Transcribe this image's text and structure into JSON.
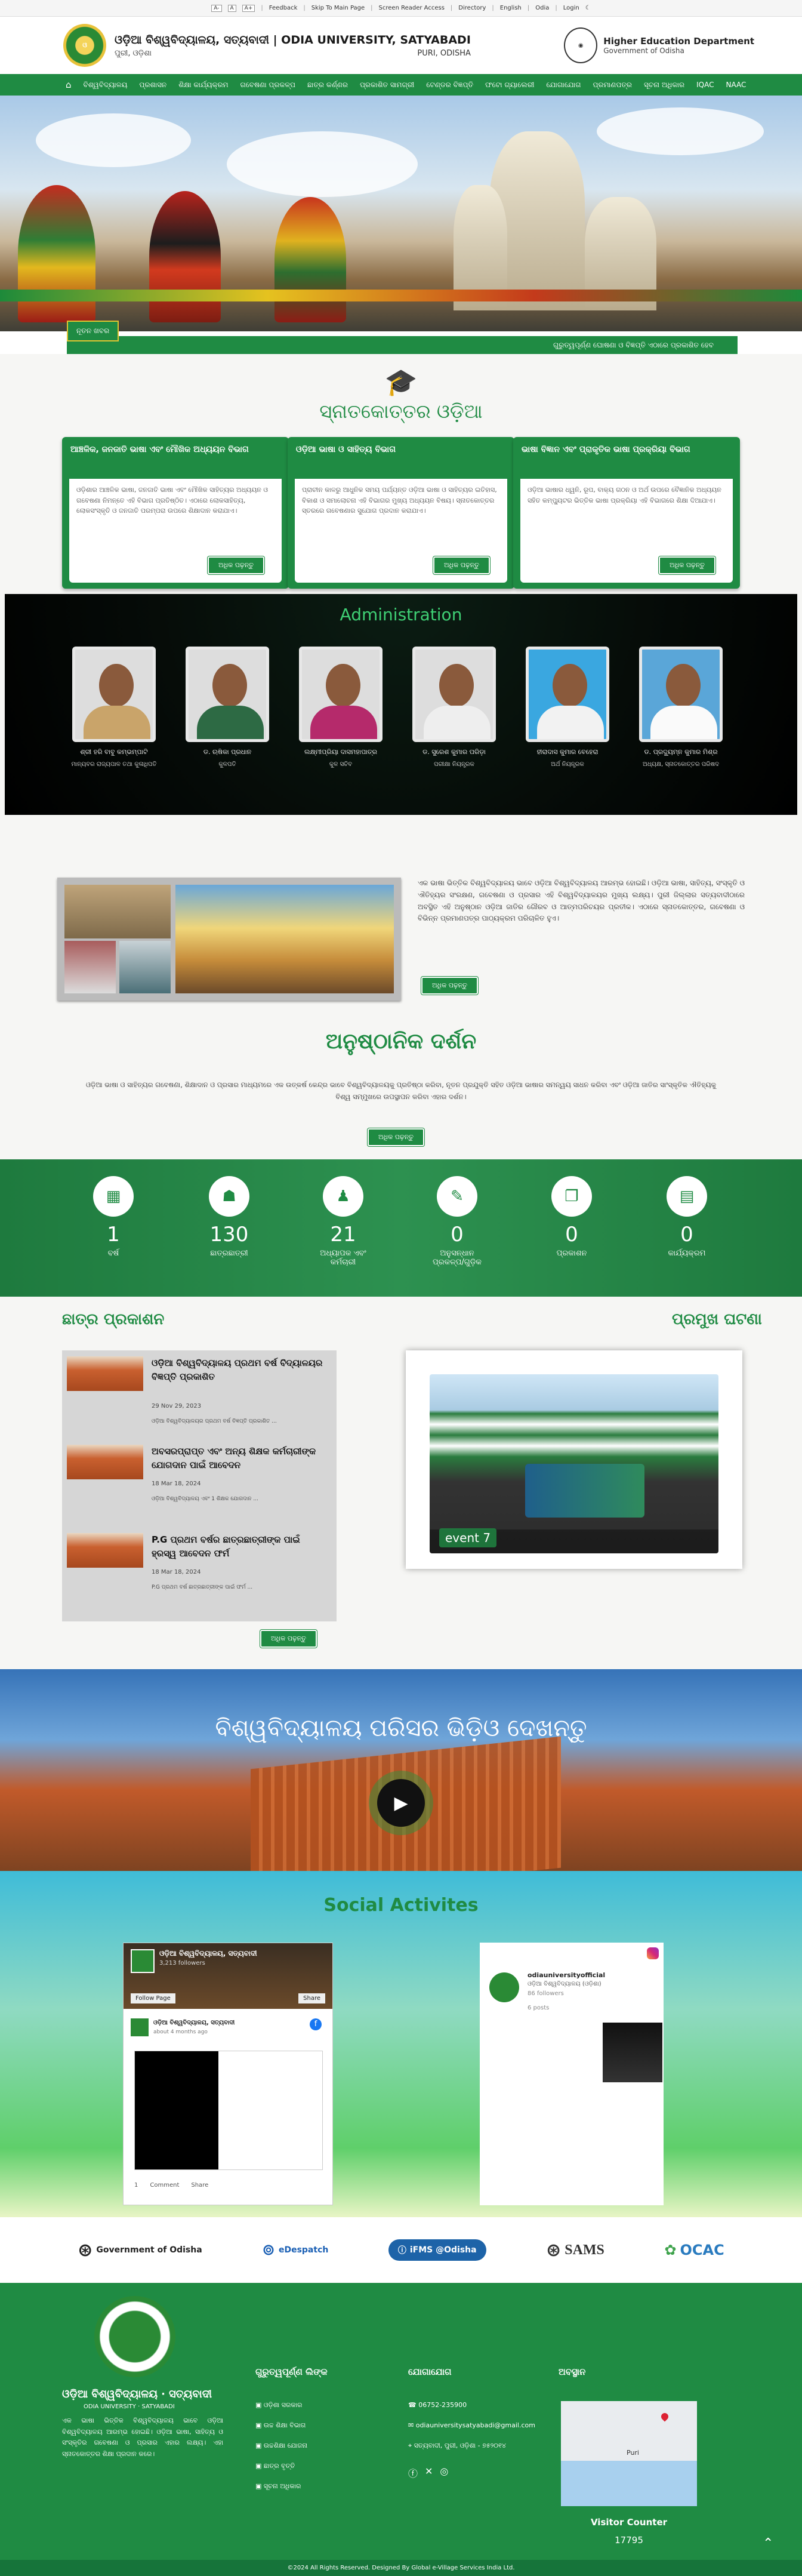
{
  "topbar": {
    "font_small": "A-",
    "font_normal": "A",
    "font_large": "A+",
    "feedback": "Feedback",
    "skip": "Skip To Main Page",
    "screen_reader": "Screen Reader Access",
    "directory": "Directory",
    "english": "English",
    "odia": "Odia",
    "login": "Login"
  },
  "header": {
    "title": "ଓଡ଼ିଆ ବିଶ୍ୱବିଦ୍ୟାଳୟ, ସତ୍ୟବାଦୀ | ODIA UNIVERSITY, SATYABADI",
    "sub_left": "ପୁରୀ, ଓଡ଼ିଶା",
    "sub_right": "PURI, ODISHA",
    "gov_title": "Higher Education Department",
    "gov_sub": "Government of Odisha"
  },
  "nav": [
    "ବିଶ୍ୱବିଦ୍ୟାଳୟ",
    "ପ୍ରଶାସନ",
    "ଶିକ୍ଷା କାର୍ଯ୍ୟକ୍ରମ",
    "ଗବେଷଣା ପ୍ରକଳ୍ପ",
    "ଛାତ୍ର କର୍ଣ୍ଣର",
    "ପ୍ରକାଶିତ ସାମଗ୍ରୀ",
    "ଟେଣ୍ଡର ବିଜ୍ଞପ୍ତି",
    "ଫଟୋ ଗ୍ୟାଲେରୀ",
    "ଯୋଗାଯୋଗ",
    "ପ୍ରମାଣପତ୍ର",
    "ସୂଚନା ଅଧିକାର",
    "IQAC",
    "NAAC"
  ],
  "news": {
    "label": "ନୂତନ ଖବର",
    "ticker": "ଗୁରୁତ୍ୱପୂର୍ଣ୍ଣ ଘୋଷଣା ଓ ବିଜ୍ଞପ୍ତି ଏଠାରେ ପ୍ରକାଶିତ ହେବ"
  },
  "courses": {
    "title": "ସ୍ନାତକୋତ୍ତର ଓଡ଼ିଆ",
    "read_more": "ଅଧିକ ପଢ଼ନ୍ତୁ",
    "cards": [
      {
        "head": "ଆଞ୍ଚଳିକ, ଜନଜାତି ଭାଷା ଏବଂ ମୌଖିକ ଅଧ୍ୟୟନ ବିଭାଗ",
        "body": "ଓଡ଼ିଶାର ଆଞ୍ଚଳିକ ଭାଷା, ଜନଜାତି ଭାଷା ଏବଂ ମୌଖିକ ସାହିତ୍ୟର ଅଧ୍ୟୟନ ଓ ଗବେଷଣା ନିମନ୍ତେ ଏହି ବିଭାଗ ପ୍ରତିଷ୍ଠିତ। ଏଠାରେ ଲୋକସାହିତ୍ୟ, ଲୋକସଂସ୍କୃତି ଓ ଜନଜାତି ପରମ୍ପରା ଉପରେ ଶିକ୍ଷାଦାନ କରାଯାଏ।"
      },
      {
        "head": "ଓଡ଼ିଆ ଭାଷା ଓ ସାହିତ୍ୟ ବିଭାଗ",
        "body": "ପ୍ରାଚୀନ କାଳରୁ ଆଧୁନିକ ସମୟ ପର୍ଯ୍ୟନ୍ତ ଓଡ଼ିଆ ଭାଷା ଓ ସାହିତ୍ୟର ଇତିହାସ, ବିକାଶ ଓ ସମାଲୋଚନା ଏହି ବିଭାଗର ମୁଖ୍ୟ ଅଧ୍ୟୟନ ବିଷୟ। ସ୍ନାତକୋତ୍ତର ସ୍ତରରେ ଗବେଷଣାର ସୁଯୋଗ ପ୍ରଦାନ କରାଯାଏ।"
      },
      {
        "head": "ଭାଷା ବିଜ୍ଞାନ ଏବଂ ପ୍ରାକୃତିକ ଭାଷା ପ୍ରକ୍ରିୟା ବିଭାଗ",
        "body": "ଓଡ଼ିଆ ଭାଷାର ଧ୍ୱନି, ରୂପ, ବାକ୍ୟ ଗଠନ ଓ ଅର୍ଥ ଉପରେ ବୈଜ୍ଞାନିକ ଅଧ୍ୟୟନ ସହିତ କମ୍ପ୍ୟୁଟର ଭିତ୍ତିକ ଭାଷା ପ୍ରକ୍ରିୟା ଏହି ବିଭାଗରେ ଶିକ୍ଷା ଦିଆଯାଏ।"
      }
    ]
  },
  "admin": {
    "title": "Administration",
    "people": [
      {
        "name": "ଶ୍ରୀ ହରି ବାବୁ କମ୍ଭମ୍ପାଟି",
        "role": "ମାନ୍ୟବର ରାଜ୍ୟପାଳ ତଥା କୁଳାଧିପତି"
      },
      {
        "name": "ଡ. ଋଷିକା ପ୍ରଧାନ",
        "role": "କୁଳପତି"
      },
      {
        "name": "ଲକ୍ଷ୍ମୀପ୍ରିୟା ଦାସମହାପାତ୍ର",
        "role": "କୁଳ ସଚିବ"
      },
      {
        "name": "ଡ. ସୁରେଶ କୁମାର ପରିଡ଼ା",
        "role": "ପରୀକ୍ଷା ନିୟନ୍ତ୍ରକ"
      },
      {
        "name": "ହୀରାଦାସ କୁମାର ବେହେରା",
        "role": "ଅର୍ଥ ନିୟନ୍ତ୍ରକ"
      },
      {
        "name": "ଡ. ପ୍ରଦ୍ୟୁମ୍ନ କୁମାର ମିଶ୍ର",
        "role": "ଅଧ୍ୟକ୍ଷ, ସ୍ନାତକୋତ୍ତର ପରିଷଦ"
      }
    ]
  },
  "about": {
    "text": "ଏକ ଭାଷା ଭିତ୍ତିକ ବିଶ୍ୱବିଦ୍ୟାଳୟ ଭାବେ ଓଡ଼ିଆ ବିଶ୍ୱବିଦ୍ୟାଳୟ ଆରମ୍ଭ ହୋଇଛି। ଓଡ଼ିଆ ଭାଷା, ସାହିତ୍ୟ, ସଂସ୍କୃତି ଓ ଐତିହ୍ୟର ସଂରକ୍ଷଣ, ଗବେଷଣା ଓ ପ୍ରସାର ଏହି ବିଶ୍ୱବିଦ୍ୟାଳୟର ମୁଖ୍ୟ ଲକ୍ଷ୍ୟ। ପୁରୀ ଜିଲ୍ଲାର ସତ୍ୟବାଦୀଠାରେ ଅବସ୍ଥିତ ଏହି ଅନୁଷ୍ଠାନ ଓଡ଼ିଆ ଜାତିର ଗୌରବ ଓ ଆତ୍ମପରିଚୟର ପ୍ରତୀକ। ଏଠାରେ ସ୍ନାତକୋତ୍ତର, ଗବେଷଣା ଓ ବିଭିନ୍ନ ପ୍ରମାଣପତ୍ର ପାଠ୍ୟକ୍ରମ ପରିଚାଳିତ ହୁଏ।",
    "read_more": "ଅଧିକ ପଢ଼ନ୍ତୁ"
  },
  "vision": {
    "title": "ଅନୁଷ୍ଠାନିକ ଦର୍ଶନ",
    "text": "ଓଡ଼ିଆ ଭାଷା ଓ ସାହିତ୍ୟର ଗବେଷଣା, ଶିକ୍ଷାଦାନ ଓ ପ୍ରସାର ମାଧ୍ୟମରେ ଏକ ଉତ୍କର୍ଷ କେନ୍ଦ୍ର ଭାବେ ବିଶ୍ୱବିଦ୍ୟାଳୟକୁ ପ୍ରତିଷ୍ଠା କରିବା, ନୂତନ ପ୍ରଯୁକ୍ତି ସହିତ ଓଡ଼ିଆ ଭାଷାର ସମନ୍ୱୟ ସାଧନ କରିବା ଏବଂ ଓଡ଼ିଆ ଜାତିର ସାଂସ୍କୃତିକ ଐତିହ୍ୟକୁ ବିଶ୍ୱ ସମ୍ମୁଖରେ ଉପସ୍ଥାପନ କରିବା ଏହାର ଦର୍ଶନ।",
    "read_more": "ଅଧିକ ପଢ଼ନ୍ତୁ"
  },
  "stats": [
    {
      "value": "1",
      "label": "ବର୍ଷ",
      "icon": "calendar-icon"
    },
    {
      "value": "130",
      "label": "ଛାତ୍ରଛାତ୍ରୀ",
      "icon": "students-icon"
    },
    {
      "value": "21",
      "label": "ଅଧ୍ୟାପକ ଏବଂ କର୍ମଚାରୀ",
      "icon": "teacher-icon"
    },
    {
      "value": "0",
      "label": "ଅନୁସନ୍ଧାନ ପ୍ରକଳ୍ପ/ଗୁଡ଼ିକ",
      "icon": "research-icon"
    },
    {
      "value": "0",
      "label": "ପ୍ରକାଶନ",
      "icon": "book-icon"
    },
    {
      "value": "0",
      "label": "କାର୍ଯ୍ୟକ୍ରମ",
      "icon": "event-icon"
    }
  ],
  "student_pubs": {
    "title": "ଛାତ୍ର ପ୍ରକାଶନ",
    "read_more": "ଅଧିକ ପଢ଼ନ୍ତୁ",
    "items": [
      {
        "title": "ଓଡ଼ିଆ ବିଶ୍ୱବିଦ୍ୟାଳୟ ପ୍ରଥମ ବର୍ଷ ବିଦ୍ୟାଳୟର ବିଜ୍ଞପ୍ତି ପ୍ରକାଶିତ",
        "date": "29 Nov 29, 2023",
        "excerpt": "ଓଡ଼ିଆ ବିଶ୍ୱବିଦ୍ୟାଳୟର ପ୍ରଥମ ବର୍ଷ ବିଜ୍ଞପ୍ତି ପ୍ରକାଶିତ ..."
      },
      {
        "title": "ଅବସରପ୍ରାପ୍ତ ଏବଂ ଅନ୍ୟ ଶିକ୍ଷକ କର୍ମଚାରୀଙ୍କ ଯୋଗଦାନ ପାଇଁ ଆବେଦନ",
        "date": "18 Mar 18, 2024",
        "excerpt": "ଓଡ଼ିଆ ବିଶ୍ୱବିଦ୍ୟାଳୟ ଏବଂ 1 ଶିକ୍ଷକ ଯୋଗଦାନ ..."
      },
      {
        "title": "P.G ପ୍ରଥମ ବର୍ଷର ଛାତ୍ରଛାତ୍ରୀଙ୍କ ପାଇଁ ହ୍ରସ୍ୱ ଆବେଦନ ଫର୍ମ",
        "date": "18 Mar 18, 2024",
        "excerpt": "P.G ପ୍ରଥମ ବର୍ଷ ଛାତ୍ରଛାତ୍ରୀଙ୍କ ପାଇଁ ଫର୍ମ ..."
      }
    ]
  },
  "events": {
    "title": "ପ୍ରମୁଖ ଘଟଣା",
    "caption": "event 7"
  },
  "video": {
    "title": "ବିଶ୍ୱବିଦ୍ୟାଳୟ ପରିସର ଭିଡ଼ିଓ ଦେଖନ୍ତୁ"
  },
  "social": {
    "title": "Social Activites",
    "fb": {
      "page": "ଓଡ଼ିଆ ବିଶ୍ୱବିଦ୍ୟାଳୟ, ସତ୍ୟବାଦୀ",
      "followers": "3,213 followers",
      "follow": "Follow Page",
      "share": "Share",
      "post_name": "ଓଡ଼ିଆ ବିଶ୍ୱବିଦ୍ୟାଳୟ, ସତ୍ୟବାଦୀ",
      "post_time": "about 4 months ago",
      "likes": "1",
      "comment": "Comment",
      "share2": "Share"
    },
    "ig": {
      "handle": "odiauniversityofficial",
      "name": "ଓଡ଼ିଆ ବିଶ୍ୱବିଦ୍ୟାଳୟ (ଓଡ଼ିଶା)",
      "followers": "86 followers",
      "posts": "6 posts"
    }
  },
  "partners": [
    {
      "name": "Government of Odisha",
      "icon": "odisha-emblem-icon"
    },
    {
      "name": "eDespatch",
      "icon": "edespatch-logo-icon"
    },
    {
      "name": "iFMS @Odisha",
      "icon": "ifms-logo-icon"
    },
    {
      "name": "SAMS",
      "icon": "sams-logo-icon"
    },
    {
      "name": "OCAC",
      "icon": "ocac-logo-icon"
    }
  ],
  "footer": {
    "name": "ଓଡ଼ିଆ ବିଶ୍ୱବିଦ୍ୟାଳୟ ‧ ସତ୍ୟବାଦୀ",
    "name_en": "ODIA UNIVERSITY ‧ SATYABADI",
    "desc": "ଏକ ଭାଷା ଭିତ୍ତିକ ବିଶ୍ୱବିଦ୍ୟାଳୟ ଭାବେ ଓଡ଼ିଆ ବିଶ୍ୱବିଦ୍ୟାଳୟ ଆରମ୍ଭ ହୋଇଛି। ଓଡ଼ିଆ ଭାଷା, ସାହିତ୍ୟ ଓ ସଂସ୍କୃତିର ଗବେଷଣା ଓ ପ୍ରସାର ଏହାର ଲକ୍ଷ୍ୟ। ଏହା ସ୍ନାତକୋତ୍ତର ଶିକ୍ଷା ପ୍ରଦାନ କରେ।",
    "links_title": "ଗୁରୁତ୍ୱପୂର୍ଣ୍ଣ ଲିଙ୍କ",
    "links": [
      "ଓଡ଼ିଶା ସରକାର",
      "ଉଚ୍ଚ ଶିକ୍ଷା ବିଭାଗ",
      "ଉଚ୍ଚଶିକ୍ଷା ଯୋଜନା",
      "ଛାତ୍ର ବୃତ୍ତି",
      "ସୂଚନା ଅଧିକାର"
    ],
    "contact_title": "ଯୋଗାଯୋଗ",
    "phone": "06752-235900",
    "email": "odiauniversitysatyabadi@gmail.com",
    "address": "ସତ୍ୟବାଦୀ, ପୁରୀ, ଓଡ଼ିଶା - ୭୫୨୦୧୪",
    "map_title": "ଅବସ୍ଥାନ",
    "map_label": "Puri",
    "visitor_label": "Visitor Counter",
    "visitor_count": "17795"
  },
  "copyright": "©2024 All Rights Reserved. Designed By Global e-Village Services India Ltd."
}
